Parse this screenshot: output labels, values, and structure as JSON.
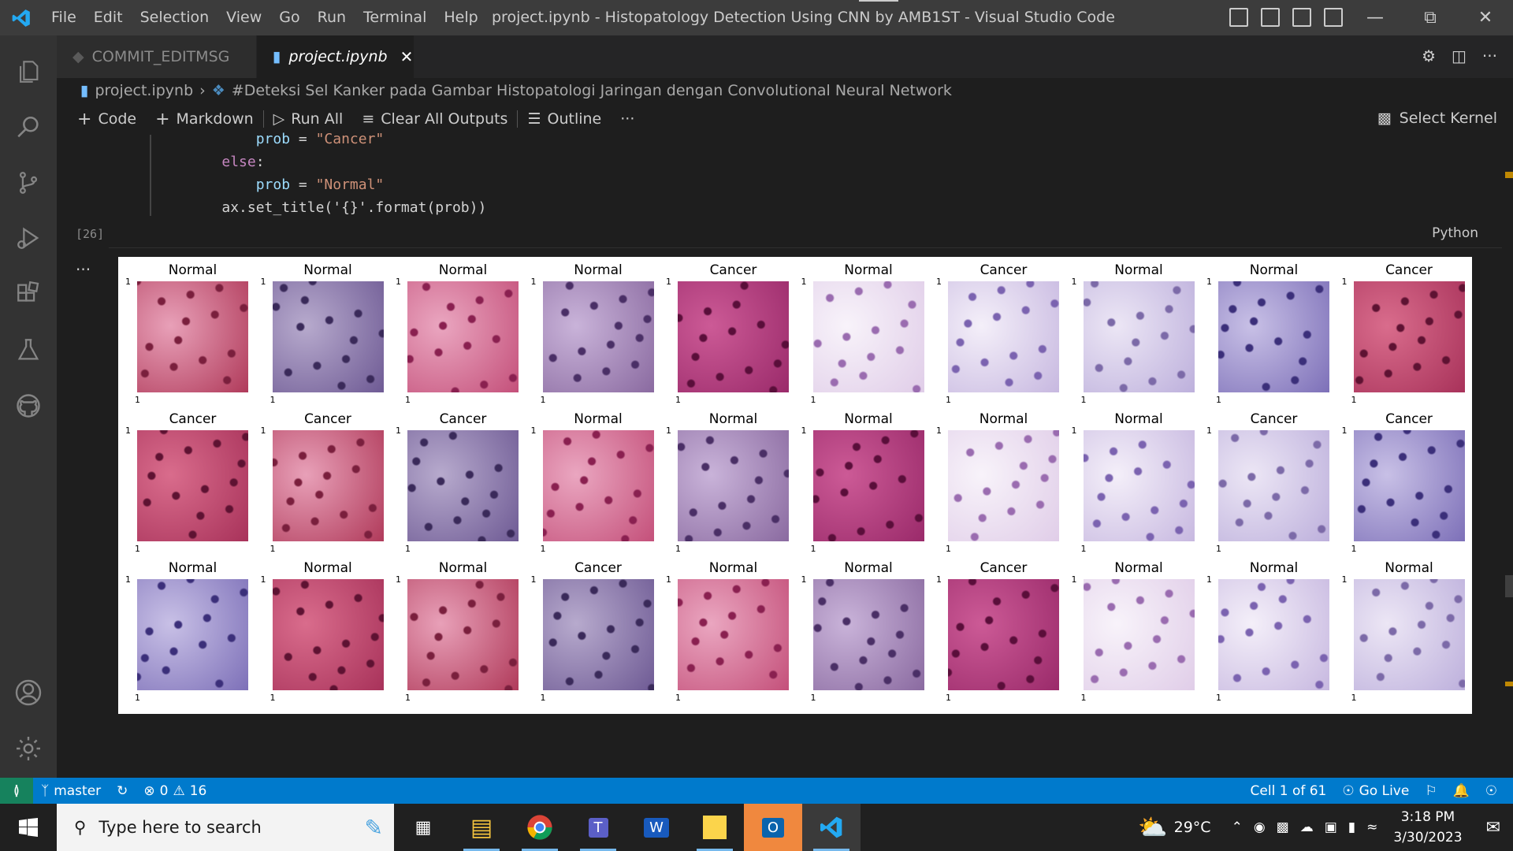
{
  "titlebar": {
    "menu": [
      "File",
      "Edit",
      "Selection",
      "View",
      "Go",
      "Run",
      "Terminal",
      "Help"
    ],
    "title": "project.ipynb - Histopatology Detection Using CNN by AMB1ST - Visual Studio Code"
  },
  "tabs": [
    {
      "label": "COMMIT_EDITMSG",
      "active": false
    },
    {
      "label": "project.ipynb",
      "active": true
    }
  ],
  "breadcrumb": {
    "file": "project.ipynb",
    "section": "#Deteksi Sel Kanker pada Gambar Histopatologi Jaringan dengan Convolutional Neural Network"
  },
  "toolbar": {
    "code": "Code",
    "markdown": "Markdown",
    "run_all": "Run All",
    "clear_outputs": "Clear All Outputs",
    "outline": "Outline",
    "more": "···",
    "kernel": "Select Kernel"
  },
  "cell": {
    "lines": [
      {
        "indent": "        ",
        "var": "prob",
        "op": " = ",
        "str": "\"Cancer\""
      },
      {
        "indent": "    ",
        "kw": "else",
        "op": ":"
      },
      {
        "indent": "        ",
        "var": "prob",
        "op": " = ",
        "str": "\"Normal\""
      },
      {
        "indent": "    ",
        "code": "ax.set_title('{}'.format(prob))"
      }
    ],
    "exec_count": "[26]",
    "language": "Python"
  },
  "output": {
    "tick": "1",
    "labels": [
      [
        "Normal",
        "Normal",
        "Normal",
        "Normal",
        "Cancer",
        "Normal",
        "Cancer",
        "Normal",
        "Normal",
        "Cancer"
      ],
      [
        "Cancer",
        "Cancer",
        "Cancer",
        "Normal",
        "Normal",
        "Normal",
        "Normal",
        "Normal",
        "Cancer",
        "Cancer"
      ],
      [
        "Normal",
        "Normal",
        "Normal",
        "Cancer",
        "Normal",
        "Normal",
        "Cancer",
        "Normal",
        "Normal",
        "Normal"
      ]
    ]
  },
  "statusbar": {
    "branch": "master",
    "errors": "0",
    "warnings": "16",
    "cell_pos": "Cell 1 of 61",
    "go_live": "Go Live"
  },
  "taskbar": {
    "search_placeholder": "Type here to search",
    "weather": "29°C",
    "time": "3:18 PM",
    "date": "3/30/2023"
  },
  "colors": {
    "accent": "#007acc",
    "remote": "#16825d"
  }
}
